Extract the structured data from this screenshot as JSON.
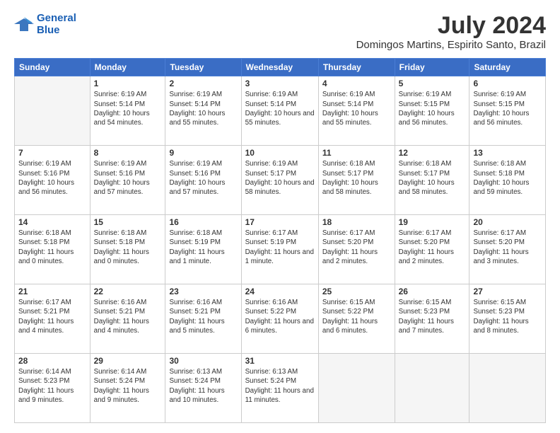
{
  "logo": {
    "line1": "General",
    "line2": "Blue"
  },
  "title": "July 2024",
  "location": "Domingos Martins, Espirito Santo, Brazil",
  "weekdays": [
    "Sunday",
    "Monday",
    "Tuesday",
    "Wednesday",
    "Thursday",
    "Friday",
    "Saturday"
  ],
  "weeks": [
    [
      {
        "day": "",
        "detail": ""
      },
      {
        "day": "1",
        "detail": "Sunrise: 6:19 AM\nSunset: 5:14 PM\nDaylight: 10 hours\nand 54 minutes."
      },
      {
        "day": "2",
        "detail": "Sunrise: 6:19 AM\nSunset: 5:14 PM\nDaylight: 10 hours\nand 55 minutes."
      },
      {
        "day": "3",
        "detail": "Sunrise: 6:19 AM\nSunset: 5:14 PM\nDaylight: 10 hours\nand 55 minutes."
      },
      {
        "day": "4",
        "detail": "Sunrise: 6:19 AM\nSunset: 5:14 PM\nDaylight: 10 hours\nand 55 minutes."
      },
      {
        "day": "5",
        "detail": "Sunrise: 6:19 AM\nSunset: 5:15 PM\nDaylight: 10 hours\nand 56 minutes."
      },
      {
        "day": "6",
        "detail": "Sunrise: 6:19 AM\nSunset: 5:15 PM\nDaylight: 10 hours\nand 56 minutes."
      }
    ],
    [
      {
        "day": "7",
        "detail": "Sunrise: 6:19 AM\nSunset: 5:16 PM\nDaylight: 10 hours\nand 56 minutes."
      },
      {
        "day": "8",
        "detail": "Sunrise: 6:19 AM\nSunset: 5:16 PM\nDaylight: 10 hours\nand 57 minutes."
      },
      {
        "day": "9",
        "detail": "Sunrise: 6:19 AM\nSunset: 5:16 PM\nDaylight: 10 hours\nand 57 minutes."
      },
      {
        "day": "10",
        "detail": "Sunrise: 6:19 AM\nSunset: 5:17 PM\nDaylight: 10 hours\nand 58 minutes."
      },
      {
        "day": "11",
        "detail": "Sunrise: 6:18 AM\nSunset: 5:17 PM\nDaylight: 10 hours\nand 58 minutes."
      },
      {
        "day": "12",
        "detail": "Sunrise: 6:18 AM\nSunset: 5:17 PM\nDaylight: 10 hours\nand 58 minutes."
      },
      {
        "day": "13",
        "detail": "Sunrise: 6:18 AM\nSunset: 5:18 PM\nDaylight: 10 hours\nand 59 minutes."
      }
    ],
    [
      {
        "day": "14",
        "detail": "Sunrise: 6:18 AM\nSunset: 5:18 PM\nDaylight: 11 hours\nand 0 minutes."
      },
      {
        "day": "15",
        "detail": "Sunrise: 6:18 AM\nSunset: 5:18 PM\nDaylight: 11 hours\nand 0 minutes."
      },
      {
        "day": "16",
        "detail": "Sunrise: 6:18 AM\nSunset: 5:19 PM\nDaylight: 11 hours\nand 1 minute."
      },
      {
        "day": "17",
        "detail": "Sunrise: 6:17 AM\nSunset: 5:19 PM\nDaylight: 11 hours\nand 1 minute."
      },
      {
        "day": "18",
        "detail": "Sunrise: 6:17 AM\nSunset: 5:20 PM\nDaylight: 11 hours\nand 2 minutes."
      },
      {
        "day": "19",
        "detail": "Sunrise: 6:17 AM\nSunset: 5:20 PM\nDaylight: 11 hours\nand 2 minutes."
      },
      {
        "day": "20",
        "detail": "Sunrise: 6:17 AM\nSunset: 5:20 PM\nDaylight: 11 hours\nand 3 minutes."
      }
    ],
    [
      {
        "day": "21",
        "detail": "Sunrise: 6:17 AM\nSunset: 5:21 PM\nDaylight: 11 hours\nand 4 minutes."
      },
      {
        "day": "22",
        "detail": "Sunrise: 6:16 AM\nSunset: 5:21 PM\nDaylight: 11 hours\nand 4 minutes."
      },
      {
        "day": "23",
        "detail": "Sunrise: 6:16 AM\nSunset: 5:21 PM\nDaylight: 11 hours\nand 5 minutes."
      },
      {
        "day": "24",
        "detail": "Sunrise: 6:16 AM\nSunset: 5:22 PM\nDaylight: 11 hours\nand 6 minutes."
      },
      {
        "day": "25",
        "detail": "Sunrise: 6:15 AM\nSunset: 5:22 PM\nDaylight: 11 hours\nand 6 minutes."
      },
      {
        "day": "26",
        "detail": "Sunrise: 6:15 AM\nSunset: 5:23 PM\nDaylight: 11 hours\nand 7 minutes."
      },
      {
        "day": "27",
        "detail": "Sunrise: 6:15 AM\nSunset: 5:23 PM\nDaylight: 11 hours\nand 8 minutes."
      }
    ],
    [
      {
        "day": "28",
        "detail": "Sunrise: 6:14 AM\nSunset: 5:23 PM\nDaylight: 11 hours\nand 9 minutes."
      },
      {
        "day": "29",
        "detail": "Sunrise: 6:14 AM\nSunset: 5:24 PM\nDaylight: 11 hours\nand 9 minutes."
      },
      {
        "day": "30",
        "detail": "Sunrise: 6:13 AM\nSunset: 5:24 PM\nDaylight: 11 hours\nand 10 minutes."
      },
      {
        "day": "31",
        "detail": "Sunrise: 6:13 AM\nSunset: 5:24 PM\nDaylight: 11 hours\nand 11 minutes."
      },
      {
        "day": "",
        "detail": ""
      },
      {
        "day": "",
        "detail": ""
      },
      {
        "day": "",
        "detail": ""
      }
    ]
  ]
}
